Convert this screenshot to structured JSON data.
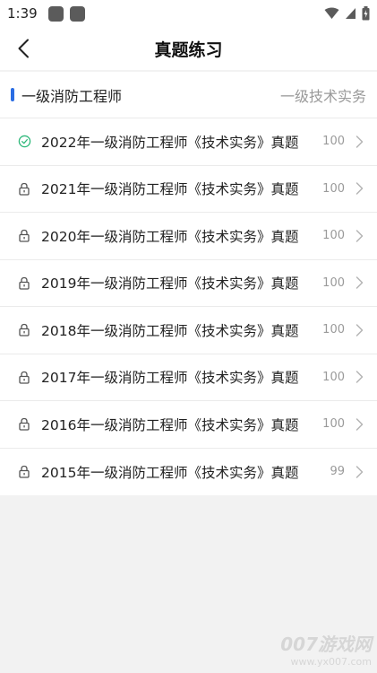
{
  "status": {
    "time": "1:39",
    "icons": [
      "app-icon",
      "app-icon",
      "wifi-icon",
      "signal-icon",
      "battery-icon"
    ]
  },
  "header": {
    "title": "真题练习",
    "back_icon": "chevron-left-icon"
  },
  "section": {
    "title": "一级消防工程师",
    "right_label": "一级技术实务",
    "accent_color": "#2b6de3"
  },
  "items": [
    {
      "label": "2022年一级消防工程师《技术实务》真题",
      "count": "100",
      "icon": "check-circle-icon"
    },
    {
      "label": "2021年一级消防工程师《技术实务》真题",
      "count": "100",
      "icon": "lock-icon"
    },
    {
      "label": "2020年一级消防工程师《技术实务》真题",
      "count": "100",
      "icon": "lock-icon"
    },
    {
      "label": "2019年一级消防工程师《技术实务》真题",
      "count": "100",
      "icon": "lock-icon"
    },
    {
      "label": "2018年一级消防工程师《技术实务》真题",
      "count": "100",
      "icon": "lock-icon"
    },
    {
      "label": "2017年一级消防工程师《技术实务》真题",
      "count": "100",
      "icon": "lock-icon"
    },
    {
      "label": "2016年一级消防工程师《技术实务》真题",
      "count": "100",
      "icon": "lock-icon"
    },
    {
      "label": "2015年一级消防工程师《技术实务》真题",
      "count": "99",
      "icon": "lock-icon"
    }
  ],
  "watermark": {
    "main": "007游戏网",
    "sub": "www.yx007.com"
  }
}
